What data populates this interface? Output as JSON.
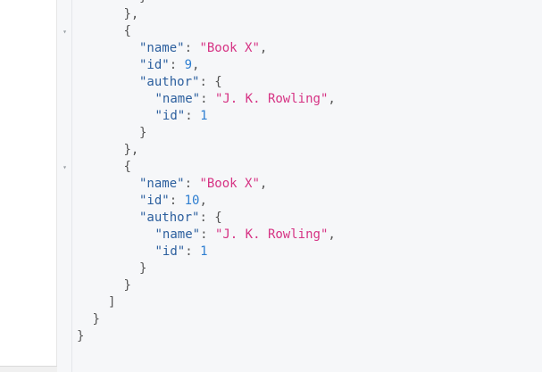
{
  "editor": {
    "fold_arrow": "▾",
    "lines": [
      {
        "indent": 4,
        "segments": [
          {
            "t": "p",
            "v": "}"
          }
        ]
      },
      {
        "indent": 3,
        "segments": [
          {
            "t": "p",
            "v": "},"
          }
        ]
      },
      {
        "indent": 3,
        "fold": true,
        "segments": [
          {
            "t": "p",
            "v": "{"
          }
        ]
      },
      {
        "indent": 4,
        "segments": [
          {
            "t": "k",
            "v": "\"name\""
          },
          {
            "t": "p",
            "v": ": "
          },
          {
            "t": "s",
            "v": "\"Book X\""
          },
          {
            "t": "p",
            "v": ","
          }
        ]
      },
      {
        "indent": 4,
        "segments": [
          {
            "t": "k",
            "v": "\"id\""
          },
          {
            "t": "p",
            "v": ": "
          },
          {
            "t": "n",
            "v": "9"
          },
          {
            "t": "p",
            "v": ","
          }
        ]
      },
      {
        "indent": 4,
        "segments": [
          {
            "t": "k",
            "v": "\"author\""
          },
          {
            "t": "p",
            "v": ": {"
          }
        ]
      },
      {
        "indent": 5,
        "segments": [
          {
            "t": "k",
            "v": "\"name\""
          },
          {
            "t": "p",
            "v": ": "
          },
          {
            "t": "s",
            "v": "\"J. K. Rowling\""
          },
          {
            "t": "p",
            "v": ","
          }
        ]
      },
      {
        "indent": 5,
        "segments": [
          {
            "t": "k",
            "v": "\"id\""
          },
          {
            "t": "p",
            "v": ": "
          },
          {
            "t": "n",
            "v": "1"
          }
        ]
      },
      {
        "indent": 4,
        "segments": [
          {
            "t": "p",
            "v": "}"
          }
        ]
      },
      {
        "indent": 3,
        "segments": [
          {
            "t": "p",
            "v": "},"
          }
        ]
      },
      {
        "indent": 3,
        "fold": true,
        "segments": [
          {
            "t": "p",
            "v": "{"
          }
        ]
      },
      {
        "indent": 4,
        "segments": [
          {
            "t": "k",
            "v": "\"name\""
          },
          {
            "t": "p",
            "v": ": "
          },
          {
            "t": "s",
            "v": "\"Book X\""
          },
          {
            "t": "p",
            "v": ","
          }
        ]
      },
      {
        "indent": 4,
        "segments": [
          {
            "t": "k",
            "v": "\"id\""
          },
          {
            "t": "p",
            "v": ": "
          },
          {
            "t": "n",
            "v": "10"
          },
          {
            "t": "p",
            "v": ","
          }
        ]
      },
      {
        "indent": 4,
        "segments": [
          {
            "t": "k",
            "v": "\"author\""
          },
          {
            "t": "p",
            "v": ": {"
          }
        ]
      },
      {
        "indent": 5,
        "segments": [
          {
            "t": "k",
            "v": "\"name\""
          },
          {
            "t": "p",
            "v": ": "
          },
          {
            "t": "s",
            "v": "\"J. K. Rowling\""
          },
          {
            "t": "p",
            "v": ","
          }
        ]
      },
      {
        "indent": 5,
        "segments": [
          {
            "t": "k",
            "v": "\"id\""
          },
          {
            "t": "p",
            "v": ": "
          },
          {
            "t": "n",
            "v": "1"
          }
        ]
      },
      {
        "indent": 4,
        "segments": [
          {
            "t": "p",
            "v": "}"
          }
        ]
      },
      {
        "indent": 3,
        "segments": [
          {
            "t": "p",
            "v": "}"
          }
        ]
      },
      {
        "indent": 2,
        "segments": [
          {
            "t": "p",
            "v": "]"
          }
        ]
      },
      {
        "indent": 1,
        "segments": [
          {
            "t": "p",
            "v": "}"
          }
        ]
      },
      {
        "indent": 0,
        "segments": [
          {
            "t": "p",
            "v": "}"
          }
        ]
      }
    ]
  },
  "colors": {
    "key": "#2c5f9e",
    "string": "#d63384",
    "number": "#2f7fd1",
    "punctuation": "#555555",
    "editor_bg": "#f6f7f9"
  }
}
